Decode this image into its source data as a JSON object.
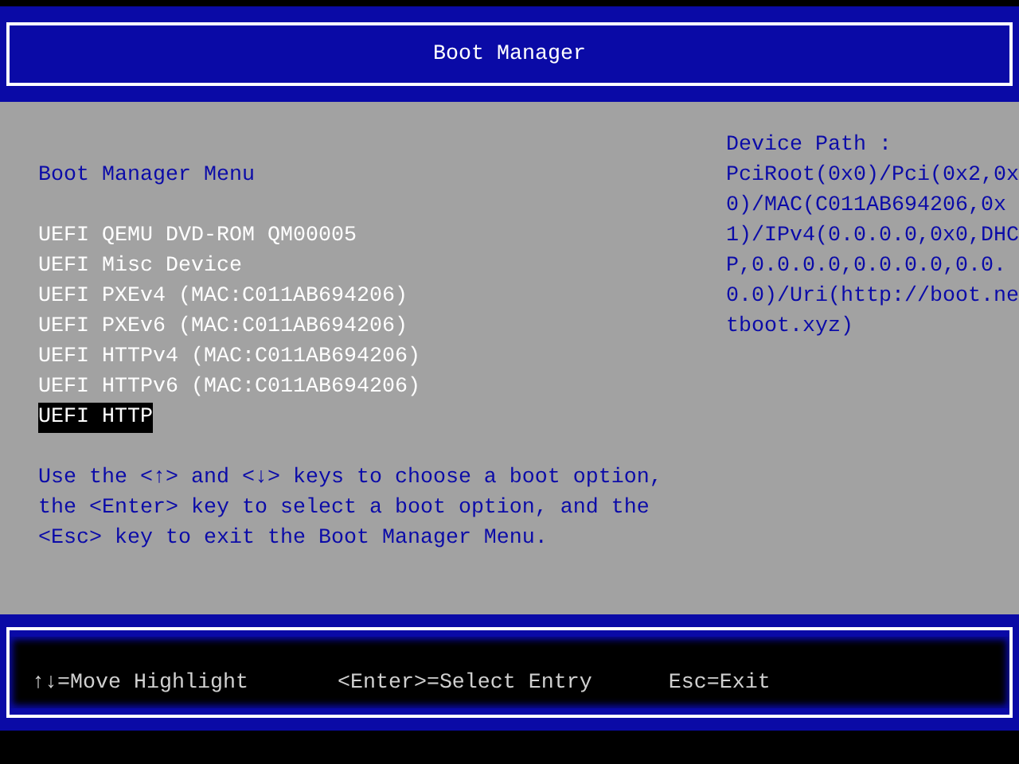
{
  "title": "Boot Manager",
  "menu_title": "Boot Manager Menu",
  "boot_options": [
    {
      "label": "UEFI QEMU DVD-ROM QM00005",
      "selected": false
    },
    {
      "label": "UEFI Misc Device",
      "selected": false
    },
    {
      "label": "UEFI PXEv4 (MAC:C011AB694206)",
      "selected": false
    },
    {
      "label": "UEFI PXEv6 (MAC:C011AB694206)",
      "selected": false
    },
    {
      "label": "UEFI HTTPv4 (MAC:C011AB694206)",
      "selected": false
    },
    {
      "label": "UEFI HTTPv6 (MAC:C011AB694206)",
      "selected": false
    },
    {
      "label": "UEFI HTTP",
      "selected": true
    }
  ],
  "help_text": "Use the <↑> and <↓> keys to choose a boot option, the <Enter> key to select a boot option, and the <Esc> key to exit the Boot Manager Menu.",
  "device_path": {
    "label": "Device Path :",
    "value": "PciRoot(0x0)/Pci(0x2,0x0)/MAC(C011AB694206,0x1)/IPv4(0.0.0.0,0x0,DHCP,0.0.0.0,0.0.0.0,0.0.0.0)/Uri(http://boot.netboot.xyz)"
  },
  "footer": [
    "↑↓=Move Highlight",
    "<Enter>=Select Entry",
    "Esc=Exit"
  ]
}
